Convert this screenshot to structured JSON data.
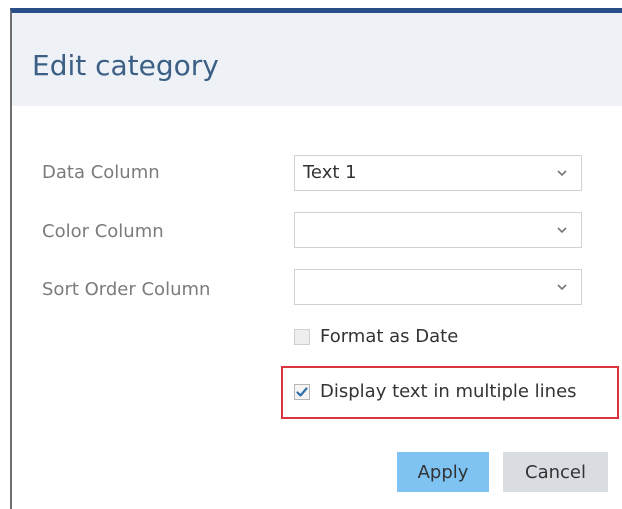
{
  "dialog": {
    "title": "Edit category"
  },
  "fields": {
    "data_column": {
      "label": "Data Column",
      "value": "Text 1"
    },
    "color_column": {
      "label": "Color Column",
      "value": ""
    },
    "sort_order_column": {
      "label": "Sort Order Column",
      "value": ""
    }
  },
  "options": {
    "format_as_date": {
      "label": "Format as Date",
      "checked": false
    },
    "multiline": {
      "label": "Display text in multiple lines",
      "checked": true
    }
  },
  "buttons": {
    "apply": "Apply",
    "cancel": "Cancel"
  },
  "colors": {
    "header_bar": "#2b4e8a",
    "title_text": "#3c5f86",
    "apply_bg": "#7fc3f3",
    "cancel_bg": "#d9dde1",
    "highlight": "#d9343f",
    "checkmark": "#2f6ea8"
  },
  "icons": {
    "dropdown": "chevron-down-icon",
    "check": "checkmark-icon"
  }
}
